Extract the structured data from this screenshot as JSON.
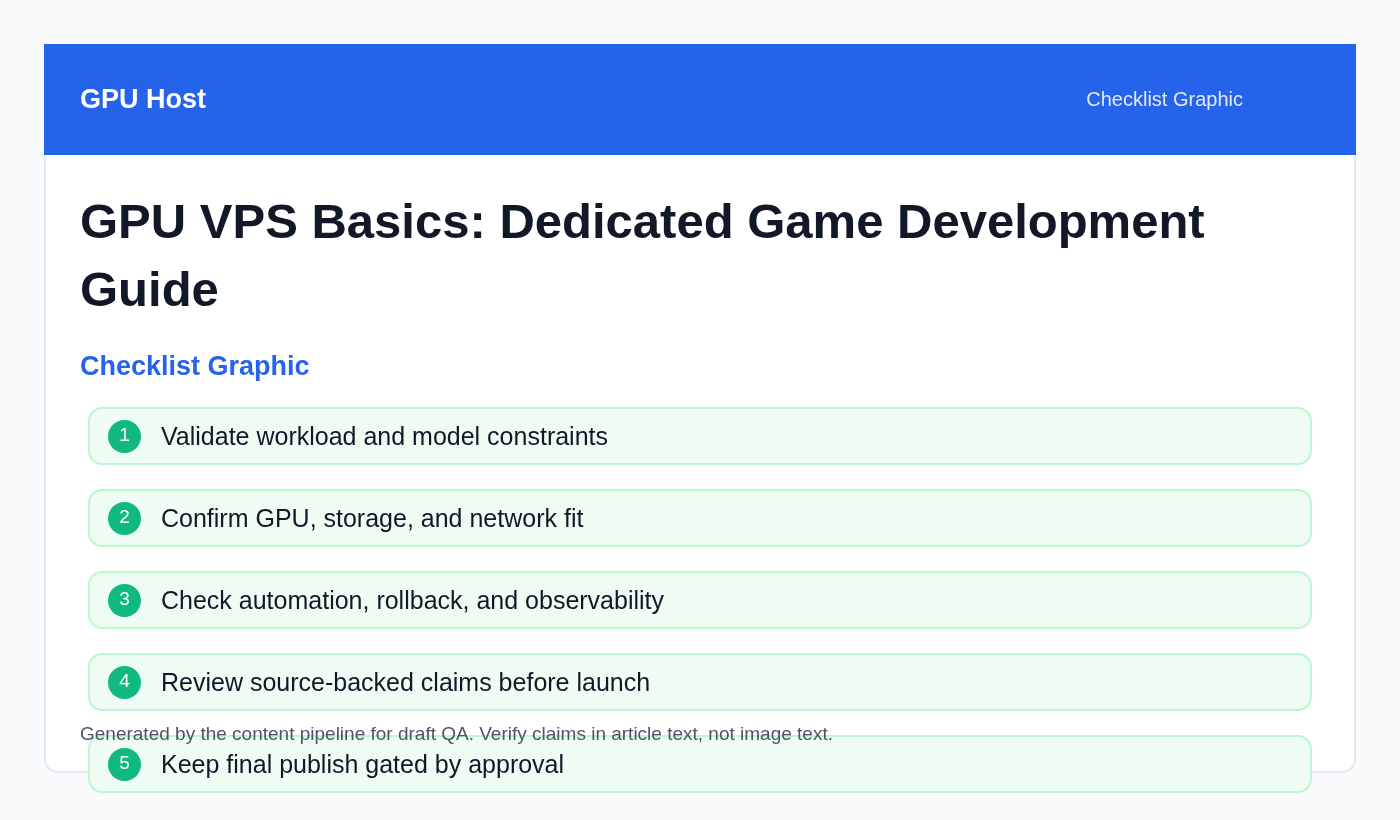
{
  "header": {
    "brand": "GPU Host",
    "nav_link": "Checklist Graphic"
  },
  "title": "GPU VPS Basics: Dedicated Game Development Guide",
  "subtitle": "Checklist Graphic",
  "checklist": [
    {
      "number": "1",
      "text": "Validate workload and model constraints"
    },
    {
      "number": "2",
      "text": "Confirm GPU, storage, and network fit"
    },
    {
      "number": "3",
      "text": "Check automation, rollback, and observability"
    },
    {
      "number": "4",
      "text": "Review source-backed claims before launch"
    },
    {
      "number": "5",
      "text": "Keep final publish gated by approval"
    }
  ],
  "footer_note": "Generated by the content pipeline for draft QA. Verify claims in article text, not image text."
}
